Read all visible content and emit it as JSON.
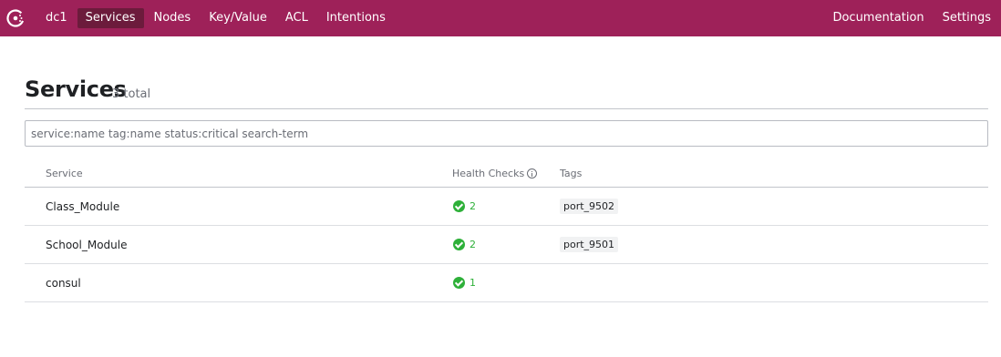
{
  "nav": {
    "logo_icon": "consul-logo-icon",
    "datacenter": "dc1",
    "items": [
      {
        "label": "Services",
        "active": true
      },
      {
        "label": "Nodes",
        "active": false
      },
      {
        "label": "Key/Value",
        "active": false
      },
      {
        "label": "ACL",
        "active": false
      },
      {
        "label": "Intentions",
        "active": false
      }
    ],
    "right_items": [
      {
        "label": "Documentation"
      },
      {
        "label": "Settings"
      }
    ]
  },
  "page": {
    "title": "Services",
    "count": "3 total"
  },
  "search": {
    "placeholder": "service:name tag:name status:critical search-term",
    "value": ""
  },
  "table": {
    "headers": {
      "service": "Service",
      "health": "Health Checks",
      "health_icon": "info-icon",
      "tags": "Tags"
    },
    "rows": [
      {
        "service": "Class_Module",
        "health_passing": "2",
        "tags": [
          "port_9502"
        ]
      },
      {
        "service": "School_Module",
        "health_passing": "2",
        "tags": [
          "port_9501"
        ]
      },
      {
        "service": "consul",
        "health_passing": "1",
        "tags": []
      }
    ]
  },
  "colors": {
    "brand": "#9e2159",
    "nav_active": "#6c1b3c",
    "passing": "#2eb039"
  }
}
